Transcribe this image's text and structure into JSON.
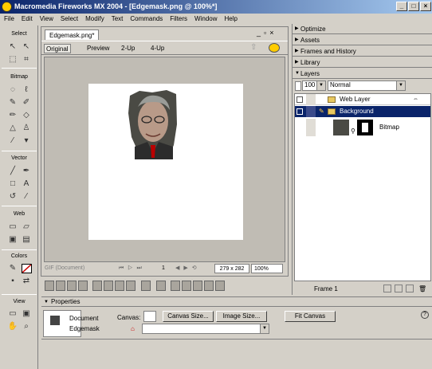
{
  "window": {
    "title": "Macromedia Fireworks MX 2004 - [Edgemask.png @ 100%*]"
  },
  "menu": [
    "File",
    "Edit",
    "View",
    "Select",
    "Modify",
    "Text",
    "Commands",
    "Filters",
    "Window",
    "Help"
  ],
  "tools": {
    "sections": [
      "Select",
      "Bitmap",
      "Vector",
      "Web",
      "Colors",
      "View"
    ]
  },
  "document": {
    "tab": "Edgemask.png*",
    "views": [
      "Original",
      "Preview",
      "2-Up",
      "4-Up"
    ],
    "status_left": "GIF (Document)",
    "page": "1",
    "size": "279 x 282",
    "zoom": "100%"
  },
  "panels": {
    "optimize": "Optimize",
    "assets": "Assets",
    "frames": "Frames and History",
    "library": "Library",
    "layers": "Layers",
    "opacity": "100",
    "blend": "Normal",
    "layer_rows": [
      {
        "name": "Web Layer"
      },
      {
        "name": "Background"
      },
      {
        "name": "Bitmap"
      }
    ],
    "frame_label": "Frame 1"
  },
  "properties": {
    "title": "Properties",
    "kind": "Document",
    "name": "Edgemask",
    "canvas_label": "Canvas:",
    "canvas_size_btn": "Canvas Size...",
    "image_size_btn": "Image Size...",
    "fit_canvas_btn": "Fit Canvas",
    "help": "?"
  },
  "colors": {
    "titlebar": "#0a246a",
    "selection": "#0a246a",
    "canvas": "#ffffff"
  }
}
